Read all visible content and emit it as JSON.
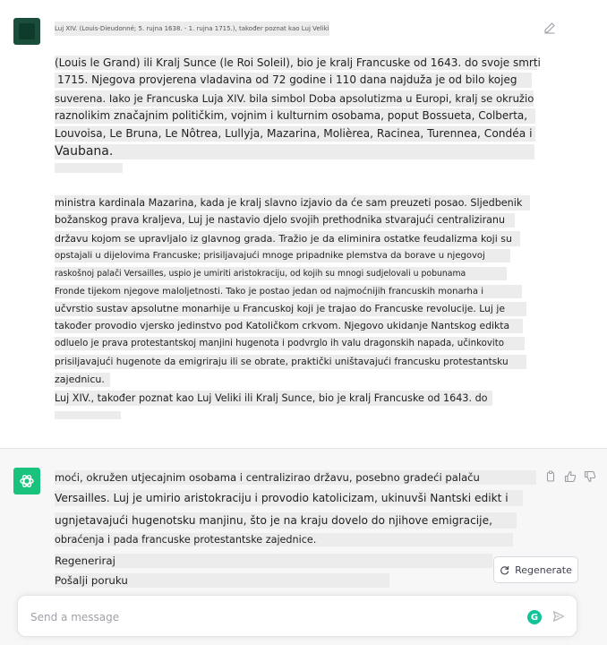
{
  "user_message": {
    "header_line": "Luj XIV. (Louis-Dieudonné; 5. rujna 1638. - 1. rujna 1715.), također poznat kao Luj Veliki",
    "paragraph1": [
      "(Louis le Grand) ili Kralj Sunce (le Roi Soleil), bio je kralj Francuske od 1643. do svoje smrti",
      "1715. Njegova provjerena vladavina od 72 godine i 110 dana najduža je od bilo kojeg",
      "suverena. Iako je Francuska Luja XIV. bila simbol Doba apsolutizma u Europi, kralj se okružio",
      "raznolikim značajnim političkim, vojnim i kulturnim osobama, poput Bossueta, Colberta,",
      "Louvoisa, Le Bruna, Le Nôtrea, Lullyja, Mazarina, Molièrea, Racinea, Turennea, Condéa i",
      "Vaubana."
    ],
    "paragraph2": [
      "ministra kardinala Mazarina, kada je kralj slavno izjavio da će sam preuzeti posao. Sljedbenik",
      "božanskog prava kraljeva, Luj je nastavio djelo svojih prethodnika stvarajući centraliziranu",
      "državu kojom se upravljalo iz glavnog grada. Tražio je da eliminira ostatke feudalizma koji su",
      "opstajali u dijelovima Francuske; prisiljavajući mnoge pripadnike plemstva da borave u njegovoj",
      "raskošnoj palači Versailles, uspio je umiriti aristokraciju, od kojih su mnogi sudjelovali u pobunama",
      "Fronde tijekom njegove maloljetnosti. Tako je postao jedan od najmoćnijih francuskih monarha i",
      "učvrstio sustav apsolutne monarhije u Francuskoj koji je trajao do Francuske revolucije. Luj je",
      "također provodio vjersko jedinstvo pod Katoličkom crkvom. Njegovo ukidanje Nantskog edikta",
      "odluelo je prava protestantskoj manjini hugenota i podvrglo ih valu dragonskih napada, učinkovito",
      "prisiljavajući hugenote da emigriraju ili se obrate, praktički uništavajući francusku protestantsku",
      "zajednicu.",
      "Luj XIV., također poznat kao Luj Veliki ili Kralj Sunce, bio je kralj Francuske od 1643. do"
    ]
  },
  "assistant_message": {
    "lines": [
      "moći, okružen utjecajnim osobama i centralizirao državu, posebno gradeći palaču",
      "Versailles. Luj je umirio aristokraciju i provodio katolicizam, ukinuvši Nantski edikt i",
      "ugnjetavajući hugenotsku manjinu, što je na kraju dovelo do njihove emigracije,",
      "obraćenja i pada francuske protestantske zajednice."
    ],
    "regenerate_text": "Regeneriraj",
    "send_text": "Pošalji poruku"
  },
  "regenerate_button": {
    "label": "Regenerate"
  },
  "composer": {
    "placeholder": "Send a message",
    "grammarly_badge": "G"
  },
  "colors": {
    "brand_green": "#19c37d",
    "user_avatar": "#1a4d3a",
    "grammarly": "#15c39a"
  }
}
